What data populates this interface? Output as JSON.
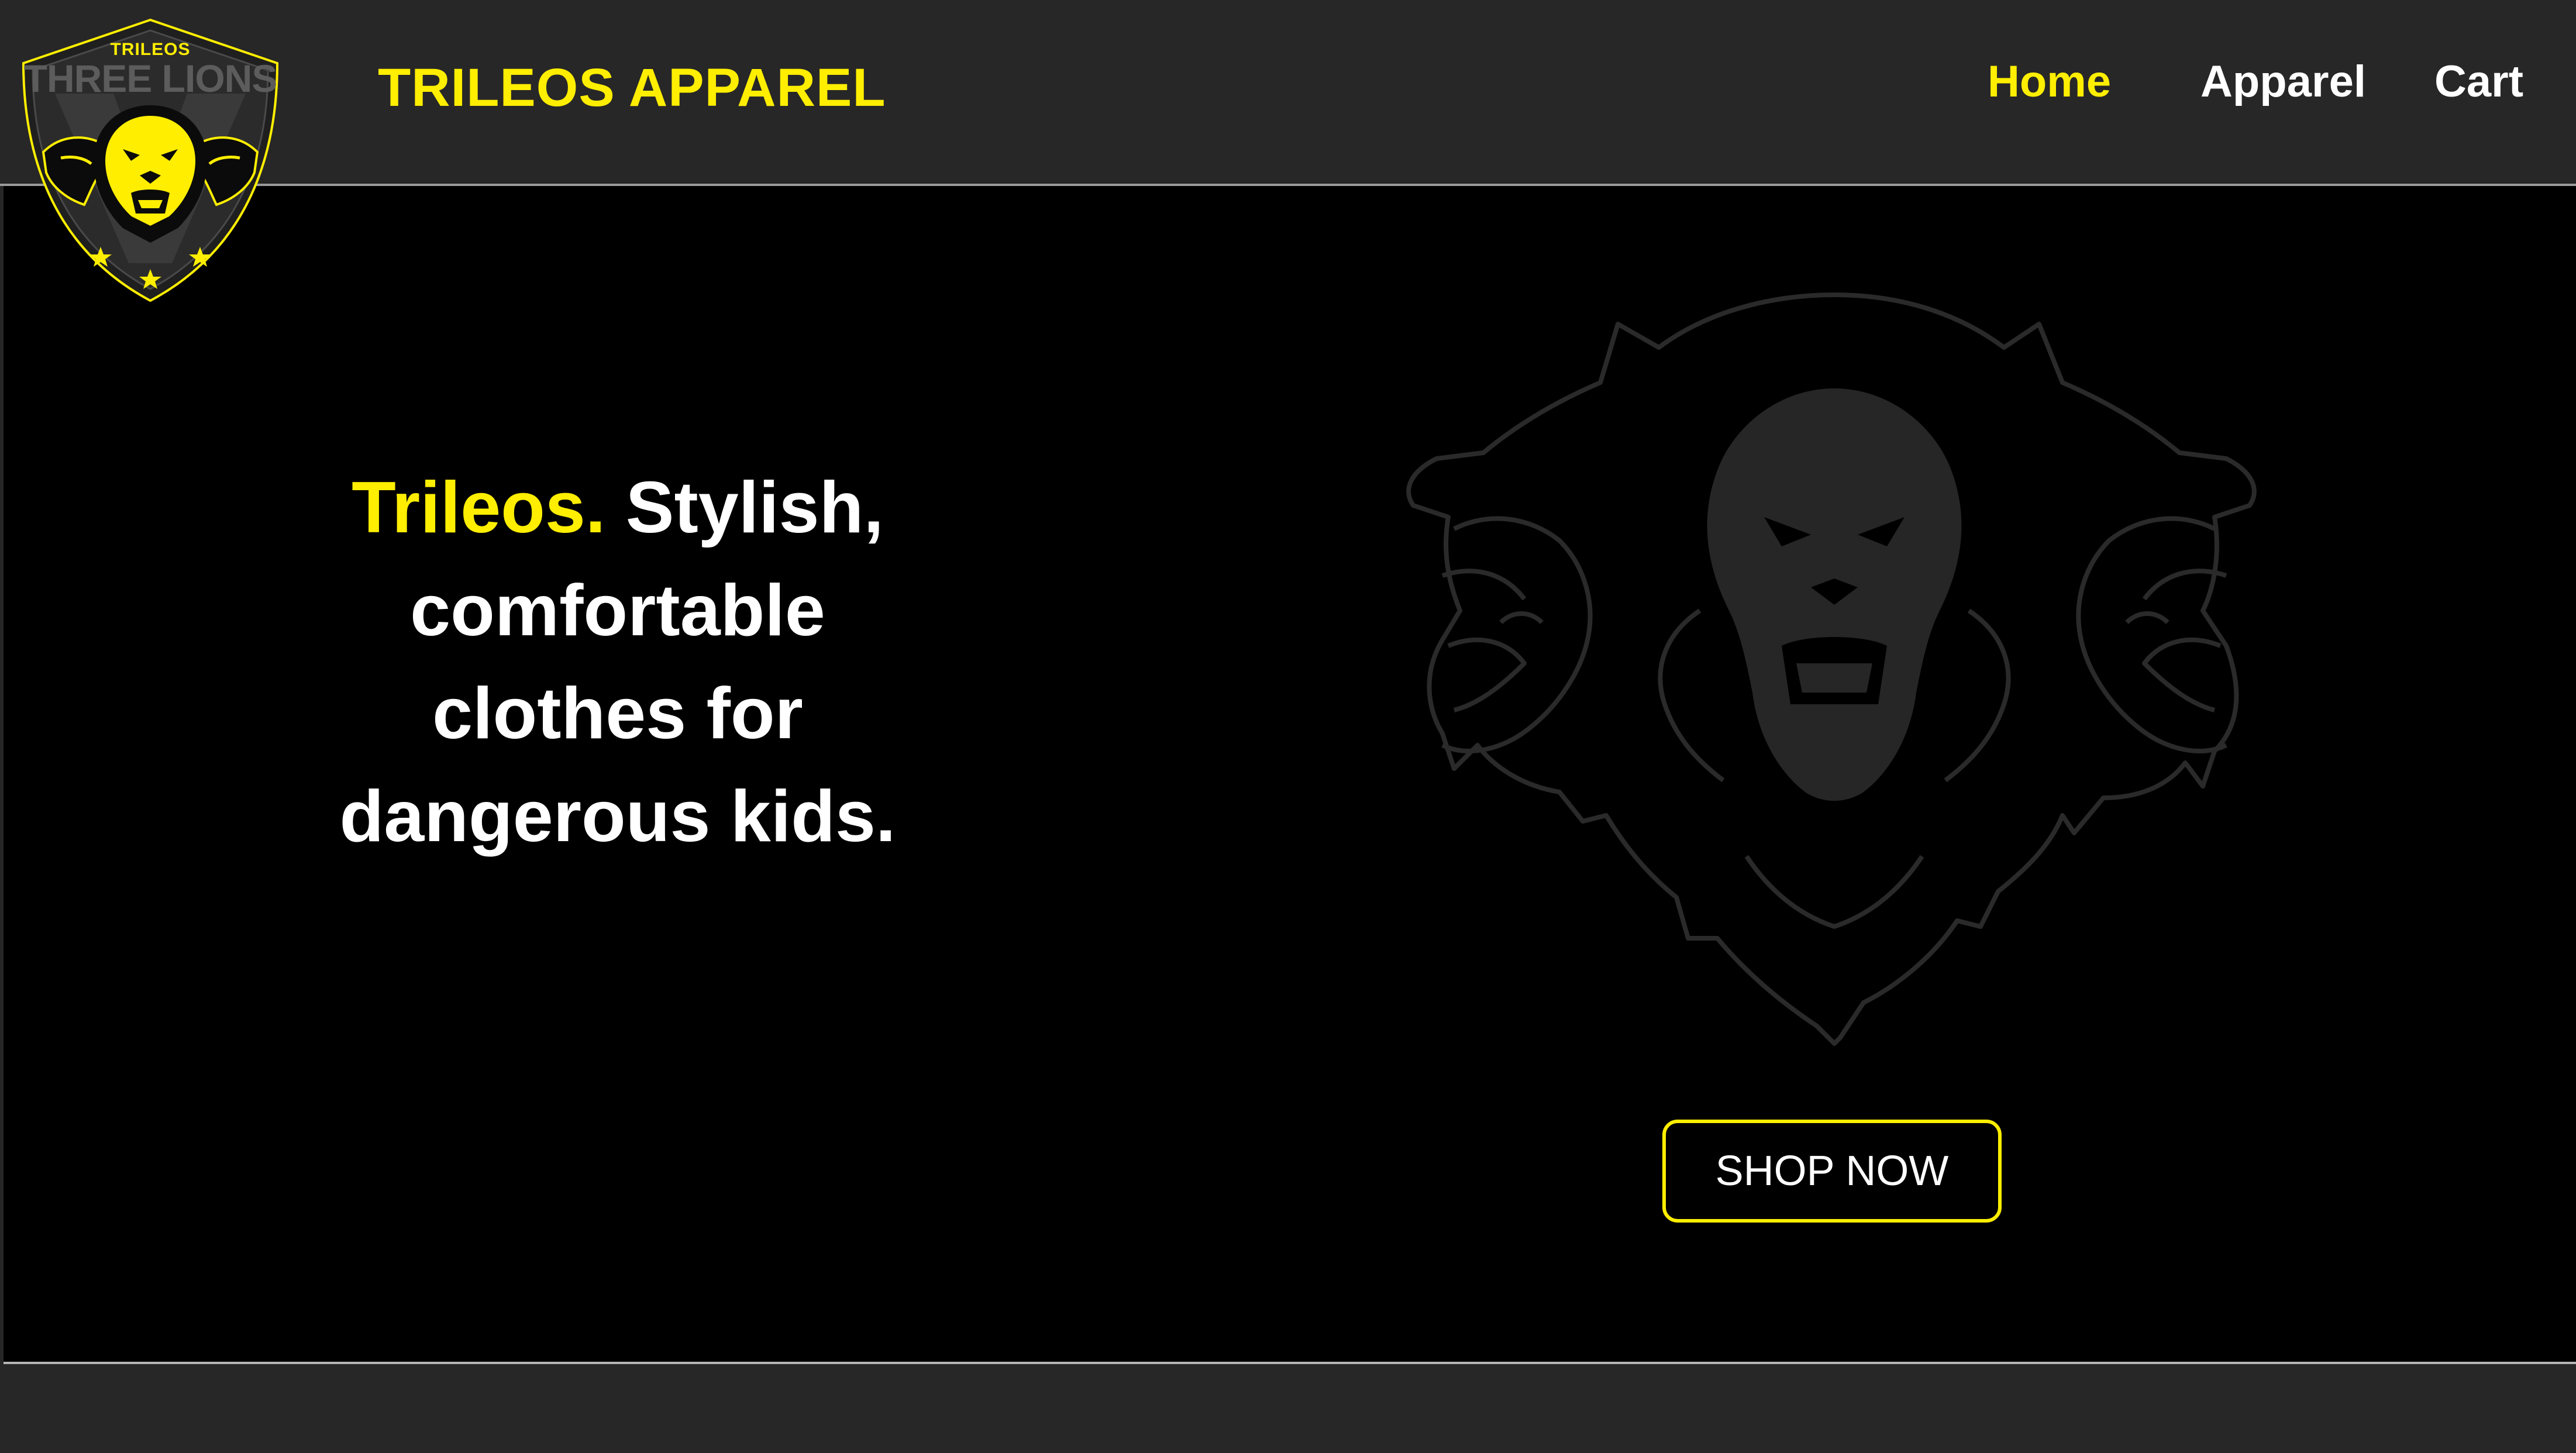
{
  "header": {
    "brand_title": "TRILEOS APPAREL",
    "nav": {
      "home": "Home",
      "apparel": "Apparel",
      "cart": "Cart"
    }
  },
  "logo": {
    "top_text": "TRILEOS",
    "name_text": "THREE LIONS",
    "icon": "three-lions-shield-icon"
  },
  "hero": {
    "headline_accent": "Trileos.",
    "headline_rest_1": "Stylish,",
    "headline_line_2": "comfortable",
    "headline_line_3": "clothes for",
    "headline_line_4": "dangerous kids.",
    "background_icon": "three-lions-outline-icon",
    "cta_label": "SHOP NOW"
  },
  "colors": {
    "accent": "#ffee00",
    "header_bg": "#272727",
    "hero_bg": "#000000",
    "text": "#ffffff"
  }
}
